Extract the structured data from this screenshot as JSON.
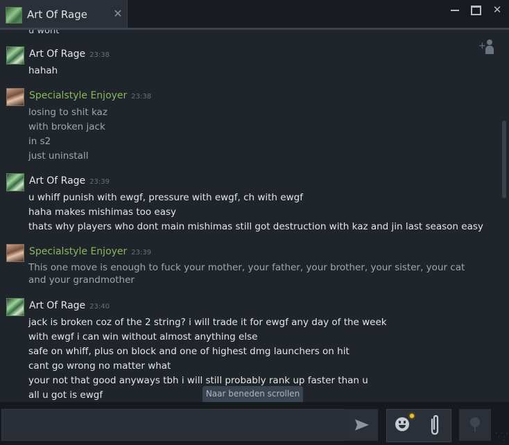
{
  "window": {
    "tab_title": "Art Of Rage",
    "tab_close": "✕",
    "close_glyph": "✕"
  },
  "chat": {
    "cut_text": "u wont",
    "messages": [
      {
        "sender": "Art Of Rage",
        "time": "23:38",
        "lines": [
          "hahah"
        ]
      },
      {
        "sender": "Specialstyle Enjoyer",
        "time": "23:38",
        "lines": [
          "losing to shit kaz",
          "with broken jack",
          "in s2",
          "just uninstall"
        ]
      },
      {
        "sender": "Art Of Rage",
        "time": "23:39",
        "lines": [
          "u whiff punish with ewgf, pressure with ewgf, ch with ewgf",
          "haha makes mishimas too easy",
          "thats why players who dont main mishimas still got destruction with kaz and jin last season easy"
        ]
      },
      {
        "sender": "Specialstyle Enjoyer",
        "time": "23:39",
        "lines": [
          "This one move is enough to fuck your mother, your father, your brother, your sister, your cat and your grandmother"
        ]
      },
      {
        "sender": "Art Of Rage",
        "time": "23:40",
        "lines": [
          "jack is broken coz of the 2 string? i will trade it for ewgf any day of the week",
          "with ewgf i can win without almost anything else",
          "safe on whiff, plus on block and one of highest dmg launchers on hit",
          "cant go wrong no matter what",
          "your not that good anyways tbh i will still probably rank up faster than u",
          "all u got is ewgf"
        ]
      }
    ],
    "scroll_down_label": "Naar beneden scrollen"
  },
  "composer": {
    "input_value": "",
    "icons": [
      "send-icon",
      "emoji-icon",
      "attach-icon",
      "microphone-icon"
    ]
  },
  "colors": {
    "friend_name": "#e6e8ea",
    "self_name": "#8ab75d",
    "notify_dot": "#f0c020"
  }
}
